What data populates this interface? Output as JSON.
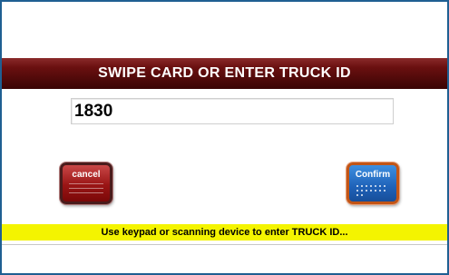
{
  "screen": {
    "title": "SWIPE CARD OR ENTER TRUCK ID",
    "truck_id_value": "1830",
    "buttons": {
      "cancel_label": "cancel",
      "confirm_label": "Confirm"
    },
    "status_message": "Use keypad or scanning device to enter TRUCK ID...",
    "colors": {
      "frame": "#1f5f92",
      "title_bar": "#6a1010",
      "cancel_button": "#9a1515",
      "confirm_button": "#1f62b8",
      "status_bar": "#f4f400"
    }
  }
}
